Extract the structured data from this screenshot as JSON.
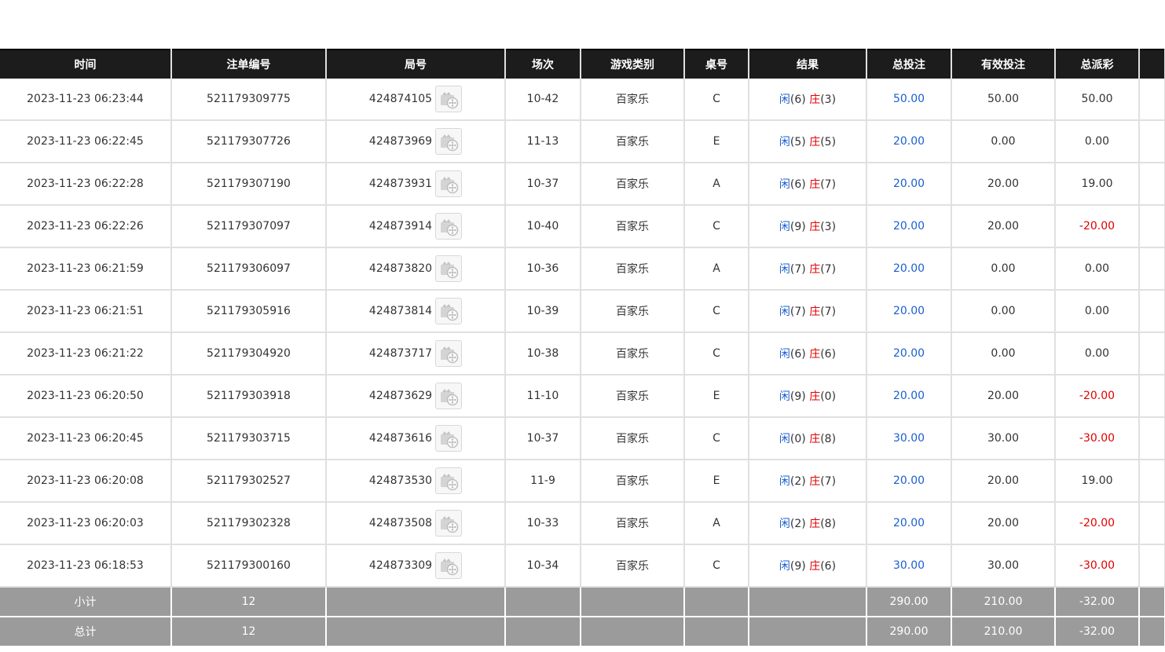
{
  "columns": [
    "时间",
    "注单编号",
    "局号",
    "场次",
    "游戏类别",
    "桌号",
    "结果",
    "总投注",
    "有效投注",
    "总派彩",
    ""
  ],
  "result_labels": {
    "player": "闲",
    "banker": "庄"
  },
  "rows": [
    {
      "time": "2023-11-23 06:23:44",
      "bet_no": "521179309775",
      "round": "424874105",
      "session": "10-42",
      "game": "百家乐",
      "table": "C",
      "player": "(6)",
      "banker": "(3)",
      "total": "50.00",
      "valid": "50.00",
      "payout": "50.00",
      "payout_negative": false
    },
    {
      "time": "2023-11-23 06:22:45",
      "bet_no": "521179307726",
      "round": "424873969",
      "session": "11-13",
      "game": "百家乐",
      "table": "E",
      "player": "(5)",
      "banker": "(5)",
      "total": "20.00",
      "valid": "0.00",
      "payout": "0.00",
      "payout_negative": false
    },
    {
      "time": "2023-11-23 06:22:28",
      "bet_no": "521179307190",
      "round": "424873931",
      "session": "10-37",
      "game": "百家乐",
      "table": "A",
      "player": "(6)",
      "banker": "(7)",
      "total": "20.00",
      "valid": "20.00",
      "payout": "19.00",
      "payout_negative": false
    },
    {
      "time": "2023-11-23 06:22:26",
      "bet_no": "521179307097",
      "round": "424873914",
      "session": "10-40",
      "game": "百家乐",
      "table": "C",
      "player": "(9)",
      "banker": "(3)",
      "total": "20.00",
      "valid": "20.00",
      "payout": "-20.00",
      "payout_negative": true
    },
    {
      "time": "2023-11-23 06:21:59",
      "bet_no": "521179306097",
      "round": "424873820",
      "session": "10-36",
      "game": "百家乐",
      "table": "A",
      "player": "(7)",
      "banker": "(7)",
      "total": "20.00",
      "valid": "0.00",
      "payout": "0.00",
      "payout_negative": false
    },
    {
      "time": "2023-11-23 06:21:51",
      "bet_no": "521179305916",
      "round": "424873814",
      "session": "10-39",
      "game": "百家乐",
      "table": "C",
      "player": "(7)",
      "banker": "(7)",
      "total": "20.00",
      "valid": "0.00",
      "payout": "0.00",
      "payout_negative": false
    },
    {
      "time": "2023-11-23 06:21:22",
      "bet_no": "521179304920",
      "round": "424873717",
      "session": "10-38",
      "game": "百家乐",
      "table": "C",
      "player": "(6)",
      "banker": "(6)",
      "total": "20.00",
      "valid": "0.00",
      "payout": "0.00",
      "payout_negative": false
    },
    {
      "time": "2023-11-23 06:20:50",
      "bet_no": "521179303918",
      "round": "424873629",
      "session": "11-10",
      "game": "百家乐",
      "table": "E",
      "player": "(9)",
      "banker": "(0)",
      "total": "20.00",
      "valid": "20.00",
      "payout": "-20.00",
      "payout_negative": true
    },
    {
      "time": "2023-11-23 06:20:45",
      "bet_no": "521179303715",
      "round": "424873616",
      "session": "10-37",
      "game": "百家乐",
      "table": "C",
      "player": "(0)",
      "banker": "(8)",
      "total": "30.00",
      "valid": "30.00",
      "payout": "-30.00",
      "payout_negative": true
    },
    {
      "time": "2023-11-23 06:20:08",
      "bet_no": "521179302527",
      "round": "424873530",
      "session": "11-9",
      "game": "百家乐",
      "table": "E",
      "player": "(2)",
      "banker": "(7)",
      "total": "20.00",
      "valid": "20.00",
      "payout": "19.00",
      "payout_negative": false
    },
    {
      "time": "2023-11-23 06:20:03",
      "bet_no": "521179302328",
      "round": "424873508",
      "session": "10-33",
      "game": "百家乐",
      "table": "A",
      "player": "(2)",
      "banker": "(8)",
      "total": "20.00",
      "valid": "20.00",
      "payout": "-20.00",
      "payout_negative": true
    },
    {
      "time": "2023-11-23 06:18:53",
      "bet_no": "521179300160",
      "round": "424873309",
      "session": "10-34",
      "game": "百家乐",
      "table": "C",
      "player": "(9)",
      "banker": "(6)",
      "total": "30.00",
      "valid": "30.00",
      "payout": "-30.00",
      "payout_negative": true
    }
  ],
  "subtotal": {
    "label": "小计",
    "count": "12",
    "total": "290.00",
    "valid": "210.00",
    "payout": "-32.00"
  },
  "grandtotal": {
    "label": "总计",
    "count": "12",
    "total": "290.00",
    "valid": "210.00",
    "payout": "-32.00"
  },
  "colors": {
    "header_bg": "#1c1c1c",
    "sum_bg": "#9b9b9b",
    "player": "#1a5fd1",
    "banker": "#e00000",
    "negative": "#e00000"
  },
  "icons": {
    "replay": "video-replay-icon"
  }
}
